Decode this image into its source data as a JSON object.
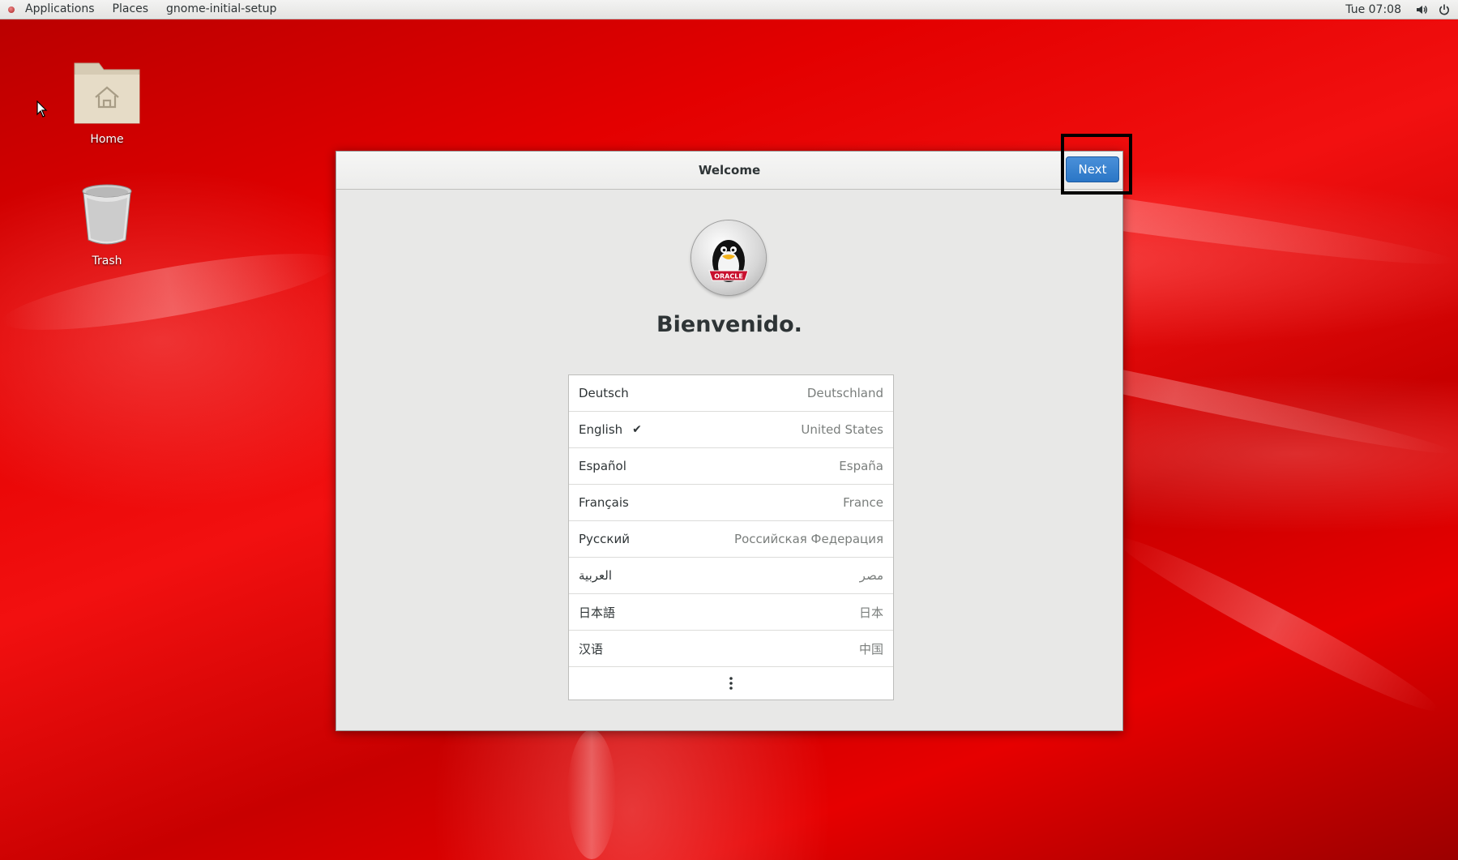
{
  "topbar": {
    "applications": "Applications",
    "places": "Places",
    "app_name": "gnome-initial-setup",
    "clock": "Tue 07:08"
  },
  "desktop": {
    "home_label": "Home",
    "trash_label": "Trash"
  },
  "dialog": {
    "title": "Welcome",
    "next_label": "Next",
    "welcome_text": "Bienvenido."
  },
  "languages": [
    {
      "name": "Deutsch",
      "region": "Deutschland",
      "selected": false
    },
    {
      "name": "English",
      "region": "United States",
      "selected": true
    },
    {
      "name": "Español",
      "region": "España",
      "selected": false
    },
    {
      "name": "Français",
      "region": "France",
      "selected": false
    },
    {
      "name": "Русский",
      "region": "Российская Федерация",
      "selected": false
    },
    {
      "name": "العربية",
      "region": "مصر",
      "selected": false
    },
    {
      "name": "日本語",
      "region": "日本",
      "selected": false
    },
    {
      "name": "汉语",
      "region": "中国",
      "selected": false
    }
  ],
  "icons": {
    "check": "check-icon",
    "more": "more-vertical-icon",
    "volume": "volume-icon",
    "power": "power-icon"
  },
  "colors": {
    "accent": "#2a76c6",
    "wallpaper": "#e30000"
  }
}
